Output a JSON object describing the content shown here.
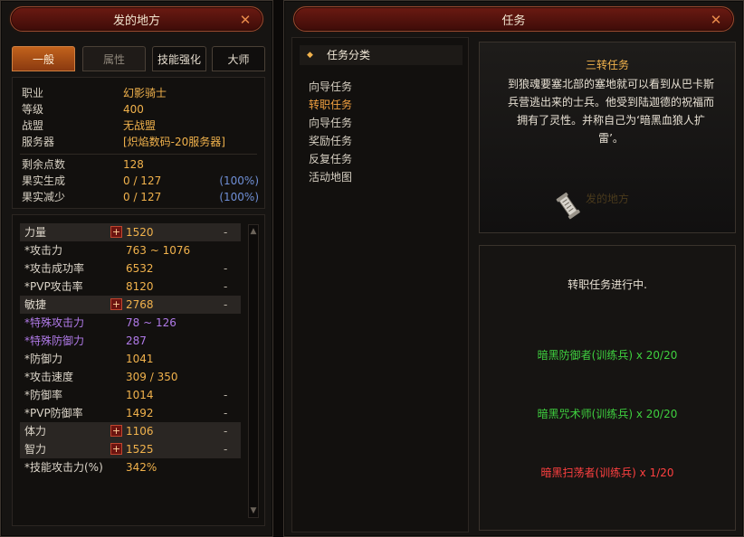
{
  "left_panel": {
    "title": "发的地方",
    "tabs": [
      "一般",
      "属性",
      "技能强化",
      "大师"
    ],
    "info": [
      {
        "label": "职业",
        "value": "幻影骑士"
      },
      {
        "label": "等级",
        "value": "400"
      },
      {
        "label": "战盟",
        "value": "无战盟"
      },
      {
        "label": "服务器",
        "value": "[炽焰数码-20服务器]"
      }
    ],
    "points": [
      {
        "label": "剩余点数",
        "value": "128",
        "pct": ""
      },
      {
        "label": "果实生成",
        "value": "0 / 127",
        "pct": "(100%)"
      },
      {
        "label": "果实减少",
        "value": "0 / 127",
        "pct": "(100%)"
      }
    ],
    "stats": [
      {
        "label": "力量",
        "value": "1520",
        "dash": "-"
      },
      {
        "label": "*攻击力",
        "value": "763 ~ 1076",
        "dash": ""
      },
      {
        "label": "*攻击成功率",
        "value": "6532",
        "dash": "-"
      },
      {
        "label": "*PVP攻击率",
        "value": "8120",
        "dash": "-"
      },
      {
        "label": "敏捷",
        "value": "2768",
        "dash": "-"
      },
      {
        "label": "*特殊攻击力",
        "value": "78 ~ 126",
        "dash": ""
      },
      {
        "label": "*特殊防御力",
        "value": "287",
        "dash": ""
      },
      {
        "label": "*防御力",
        "value": "1041",
        "dash": ""
      },
      {
        "label": "*攻击速度",
        "value": "309 / 350",
        "dash": ""
      },
      {
        "label": "*防御率",
        "value": "1014",
        "dash": "-"
      },
      {
        "label": "*PVP防御率",
        "value": "1492",
        "dash": "-"
      },
      {
        "label": "体力",
        "value": "1106",
        "dash": "-"
      },
      {
        "label": "智力",
        "value": "1525",
        "dash": "-"
      },
      {
        "label": "*技能攻击力(%)",
        "value": "342%",
        "dash": ""
      }
    ],
    "plus_symbol": "+"
  },
  "quest_panel": {
    "title": "任务",
    "category_title": "任务分类",
    "categories": [
      "向导任务",
      "转职任务",
      "向导任务",
      "奖励任务",
      "反复任务",
      "活动地图"
    ],
    "selected_category": "转职任务",
    "quest_title": "三转任务",
    "quest_desc": "到狼魂要塞北部的塞地就可以看到从巴卡斯兵营逃出来的士兵。他受到陆迦德的祝福而拥有了灵性。并称自己为‘暗黑血狼人扩雷’。",
    "watermark": "发的地方",
    "progress_state": "转职任务进行中.",
    "objectives": [
      {
        "text": "暗黑防御者(训练兵) x 20/20",
        "color": "#3fd03f"
      },
      {
        "text": "暗黑咒术师(训练兵) x 20/20",
        "color": "#3fd03f"
      },
      {
        "text": "暗黑扫荡者(训练兵) x 1/20",
        "color": "#ff4040"
      }
    ]
  },
  "icons": {
    "close": "close-x-icon",
    "bullet": "diamond-bullet-icon",
    "quest_item": "scroll-item-icon",
    "scroll_up": "scroll-up-arrow-icon",
    "scroll_down": "scroll-down-arrow-icon"
  },
  "colors": {
    "value_gold": "#f1b24c",
    "special_purple": "#b07ae8",
    "pct_blue": "#6f8fd6",
    "complete_green": "#3fd03f",
    "incomplete_red": "#ff4040",
    "selected_orange": "#f1a040"
  }
}
